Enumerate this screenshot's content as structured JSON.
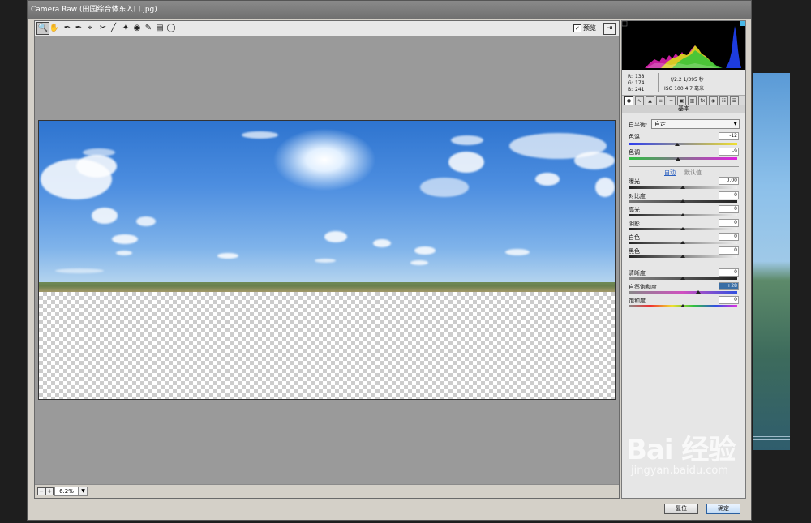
{
  "window": {
    "title": "Camera Raw (田园综合体东入口.jpg)"
  },
  "toolbar": {
    "tools": [
      "zoom-tool",
      "hand-tool",
      "white-balance-tool",
      "color-sampler-tool",
      "targeted-adjustment-tool",
      "crop-tool",
      "straighten-tool",
      "spot-removal-tool",
      "red-eye-tool",
      "adjustment-brush",
      "graduated-filter",
      "radial-filter"
    ],
    "preview_label": "预览",
    "preview_checked": true
  },
  "status": {
    "zoom": "6.2%"
  },
  "info": {
    "r_label": "R:",
    "r": "138",
    "g_label": "G:",
    "g": "174",
    "b_label": "B:",
    "b": "241",
    "exposure": "f/2.2  1/395 秒",
    "iso": "ISO 100  4.7 毫米"
  },
  "panel": {
    "section_title": "基本",
    "wb_label": "白平衡:",
    "wb_value": "自定",
    "temp": {
      "label": "色温",
      "value": "-12"
    },
    "tint": {
      "label": "色调",
      "value": "-9"
    },
    "auto_label": "自动",
    "default_label": "默认值",
    "exposure": {
      "label": "曝光",
      "value": "0.00"
    },
    "contrast": {
      "label": "对比度",
      "value": "0"
    },
    "highlights": {
      "label": "高光",
      "value": "0"
    },
    "shadows": {
      "label": "阴影",
      "value": "0"
    },
    "whites": {
      "label": "白色",
      "value": "0"
    },
    "blacks": {
      "label": "黑色",
      "value": "0"
    },
    "clarity": {
      "label": "清晰度",
      "value": "0"
    },
    "vibrance": {
      "label": "自然饱和度",
      "value": "+28"
    },
    "saturation": {
      "label": "饱和度",
      "value": "0"
    }
  },
  "buttons": {
    "reset": "复位",
    "ok": "确定"
  },
  "watermark": {
    "brand": "Bai 经验",
    "url": "jingyan.baidu.com"
  }
}
